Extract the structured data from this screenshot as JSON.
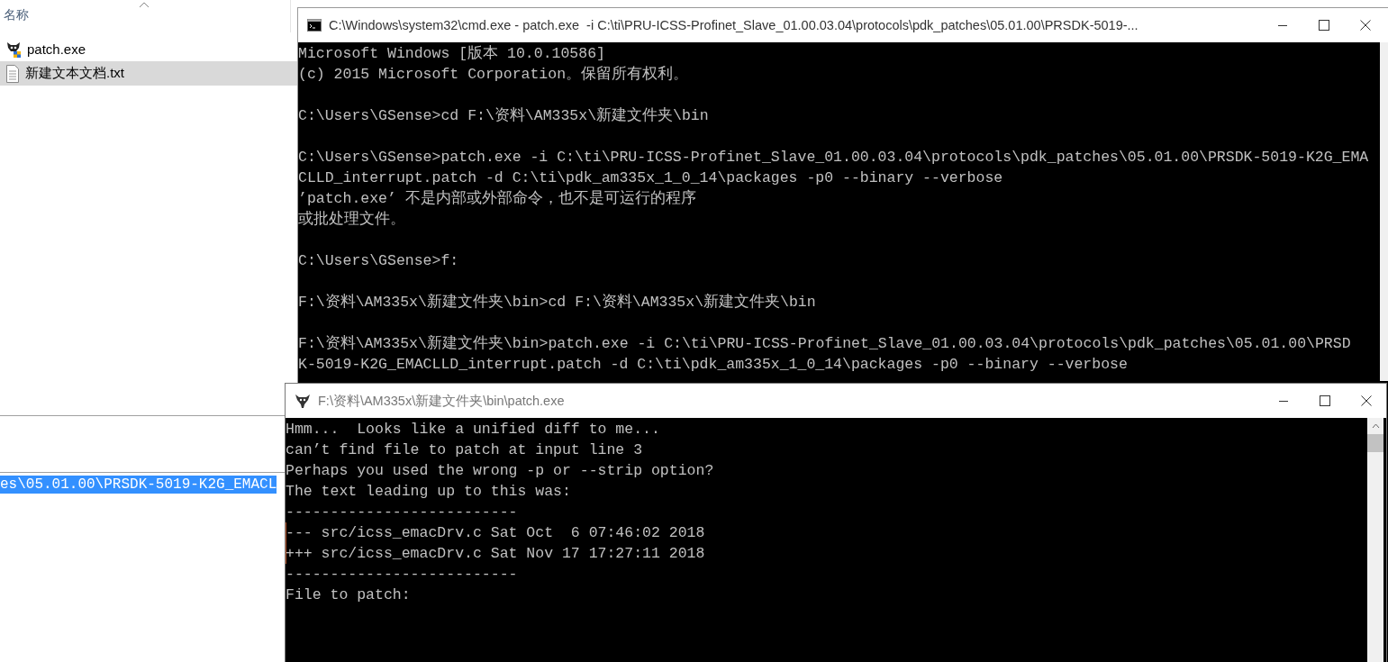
{
  "explorer": {
    "column_header": "名称",
    "files": [
      {
        "name": "patch.exe",
        "kind": "program",
        "selected": false
      },
      {
        "name": "新建文本文档.txt",
        "kind": "text",
        "selected": true
      }
    ]
  },
  "background_console": {
    "selected_text": "es\\05.01.00\\PRSDK-5019-K2G_EMACL"
  },
  "cmd_window": {
    "title": "C:\\Windows\\system32\\cmd.exe - patch.exe  -i C:\\ti\\PRU-ICSS-Profinet_Slave_01.00.03.04\\protocols\\pdk_patches\\05.01.00\\PRSDK-5019-...",
    "blocks": [
      [
        "Microsoft Windows [版本 10.0.10586]",
        "(c) 2015 Microsoft Corporation。保留所有权利。"
      ],
      [
        "C:\\Users\\GSense>cd F:\\资料\\AM335x\\新建文件夹\\bin"
      ],
      [
        "C:\\Users\\GSense>patch.exe -i C:\\ti\\PRU-ICSS-Profinet_Slave_01.00.03.04\\protocols\\pdk_patches\\05.01.00\\PRSDK-5019-K2G_EMA",
        "CLLD_interrupt.patch -d C:\\ti\\pdk_am335x_1_0_14\\packages -p0 --binary --verbose",
        "’patch.exe’ 不是内部或外部命令，也不是可运行的程序",
        "或批处理文件。"
      ],
      [
        "C:\\Users\\GSense>f:"
      ],
      [
        "F:\\资料\\AM335x\\新建文件夹\\bin>cd F:\\资料\\AM335x\\新建文件夹\\bin"
      ],
      [
        "F:\\资料\\AM335x\\新建文件夹\\bin>patch.exe -i C:\\ti\\PRU-ICSS-Profinet_Slave_01.00.03.04\\protocols\\pdk_patches\\05.01.00\\PRSD",
        "K-5019-K2G_EMACLLD_interrupt.patch -d C:\\ti\\pdk_am335x_1_0_14\\packages -p0 --binary --verbose"
      ]
    ]
  },
  "patch_window": {
    "title": "F:\\资料\\AM335x\\新建文件夹\\bin\\patch.exe",
    "lines": [
      {
        "text": "Hmm...  Looks like a unified diff to me...",
        "marked": false
      },
      {
        "text": "can’t find file to patch at input line 3",
        "marked": false
      },
      {
        "text": "Perhaps you used the wrong -p or --strip option?",
        "marked": false
      },
      {
        "text": "The text leading up to this was:",
        "marked": false
      },
      {
        "text": "--------------------------",
        "marked": false
      },
      {
        "text": "--- src/icss_emacDrv.c Sat Oct  6 07:46:02 2018",
        "marked": true
      },
      {
        "text": "+++ src/icss_emacDrv.c Sat Nov 17 17:27:11 2018",
        "marked": true
      },
      {
        "text": "--------------------------",
        "marked": false
      },
      {
        "text": "File to patch:",
        "marked": false
      }
    ]
  }
}
